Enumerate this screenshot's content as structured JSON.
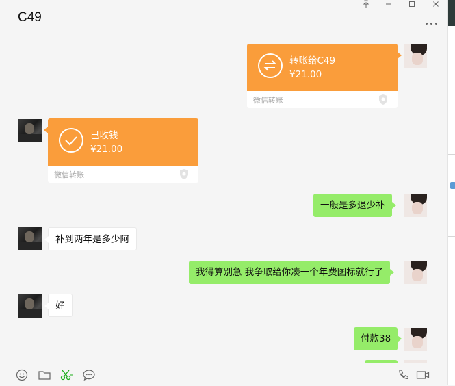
{
  "window": {
    "title": "C49",
    "controls": [
      "pin-icon",
      "minimize-icon",
      "maximize-icon",
      "close-icon"
    ]
  },
  "messages": [
    {
      "side": "right",
      "type": "transfer",
      "title": "转账给C49",
      "amount": "¥21.00",
      "footer": "微信转账",
      "icon": "transfer-arrows-icon"
    },
    {
      "side": "left",
      "type": "transfer",
      "title": "已收钱",
      "amount": "¥21.00",
      "footer": "微信转账",
      "icon": "check-icon"
    },
    {
      "side": "right",
      "type": "text",
      "text": "一般是多退少补"
    },
    {
      "side": "left",
      "type": "text",
      "text": "补到两年是多少阿"
    },
    {
      "side": "right",
      "type": "text",
      "text": "我得算别急 我争取给你凑一个年费图标就行了"
    },
    {
      "side": "left",
      "type": "text",
      "text": "好"
    },
    {
      "side": "right",
      "type": "text",
      "text": "付款38"
    }
  ],
  "toolbar": {
    "left": [
      "emoji-icon",
      "folder-icon",
      "scissors-icon",
      "chat-history-icon"
    ],
    "right": [
      "phone-icon",
      "video-icon"
    ]
  },
  "colors": {
    "transfer_orange": "#fa9d3b",
    "my_bubble": "#95ec69",
    "their_bubble": "#ffffff",
    "background": "#f5f5f5"
  }
}
